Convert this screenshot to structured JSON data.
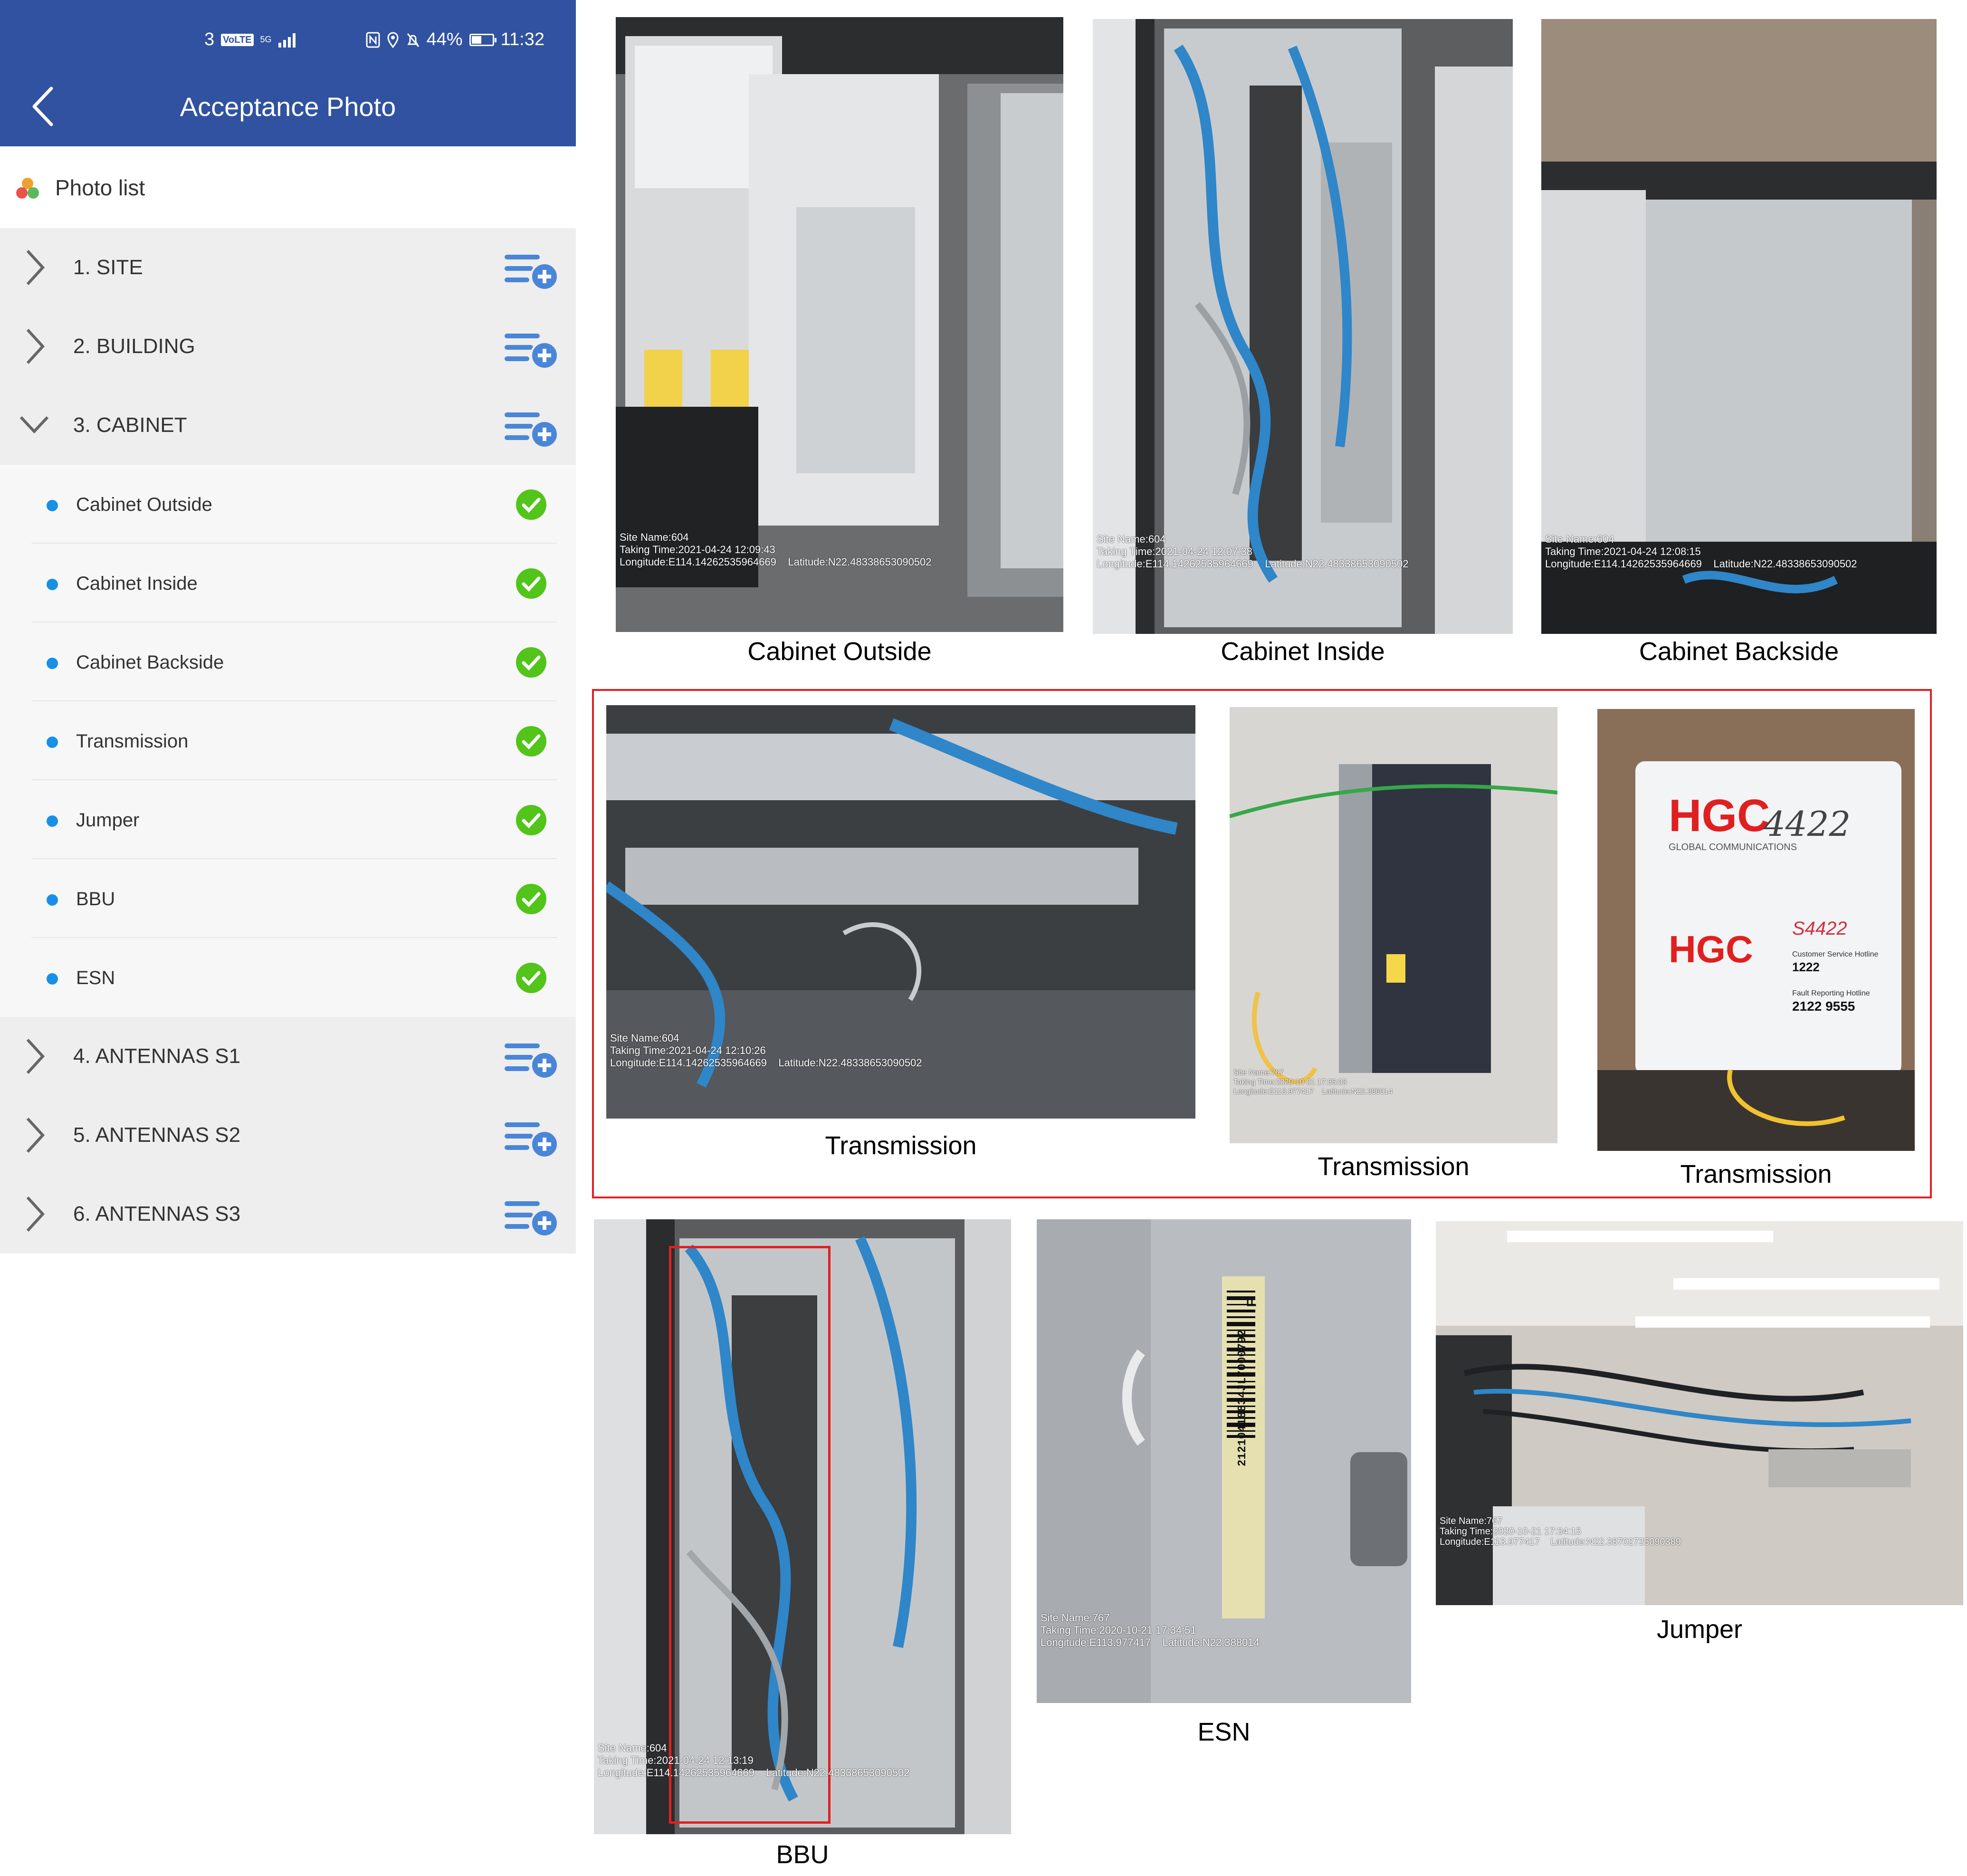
{
  "status_bar": {
    "network_left": "3",
    "volte": "VoLTE",
    "network_type": "5G",
    "battery": "44%",
    "time": "11:32"
  },
  "header": {
    "title": "Acceptance Photo"
  },
  "photo_list": {
    "label": "Photo list"
  },
  "groups": [
    {
      "label": "1. SITE"
    },
    {
      "label": "2. BUILDING"
    },
    {
      "label": "3. CABINET"
    },
    {
      "label": "4. ANTENNAS S1"
    },
    {
      "label": "5. ANTENNAS S2"
    },
    {
      "label": "6. ANTENNAS S3"
    }
  ],
  "cabinet_items": [
    {
      "label": "Cabinet Outside",
      "status": "done"
    },
    {
      "label": "Cabinet Inside",
      "status": "done"
    },
    {
      "label": "Cabinet Backside",
      "status": "done"
    },
    {
      "label": "Transmission",
      "status": "done"
    },
    {
      "label": "Jumper",
      "status": "done"
    },
    {
      "label": "BBU",
      "status": "done"
    },
    {
      "label": "ESN",
      "status": "done"
    }
  ],
  "photos": [
    {
      "caption": "Cabinet Outside",
      "overlay": "Site Name:604\nTaking Time:2021-04-24 12:09:43\nLongitude:E114.14262535964669    Latitude:N22.48338653090502"
    },
    {
      "caption": "Cabinet Inside",
      "overlay": "Site Name:604\nTaking Time:2021-04-24 12:07:38\nLongitude:E114.14262535964669    Latitude:N22.48338653090502"
    },
    {
      "caption": "Cabinet Backside",
      "overlay": "Site Name:604\nTaking Time:2021-04-24 12:08:15\nLongitude:E114.14262535964669    Latitude:N22.48338653090502"
    },
    {
      "caption": "Transmission",
      "overlay": "Site Name:604\nTaking Time:2021-04-24 12:10:26\nLongitude:E114.14262535964669    Latitude:N22.48338653090502"
    },
    {
      "caption": "Transmission",
      "overlay": "Site Name:767\nTaking Time:2020-10-21 17:35:03\nLongitude:E113.977417    Latitude:N22.388014"
    },
    {
      "caption": "Transmission",
      "overlay": ""
    },
    {
      "caption": "BBU",
      "overlay": "Site Name:604\nTaking Time:2021-04-24 12:13:19\nLongitude:E114.14262535964669    Latitude:N22.48338653090502"
    },
    {
      "caption": "ESN",
      "overlay": "Site Name:767\nTaking Time:2020-10-21 17:34:51\nLongitude:E113.977417    Latitude:N22.388014"
    },
    {
      "caption": "Jumper",
      "overlay": "Site Name:767\nTaking Time:2020-10-21 17:34:15\nLongitude:E113.977417    Latitude:N22.38702725090389"
    }
  ],
  "hgc_label": {
    "brand": "HGC",
    "handwritten_code": "4422",
    "company": "GLOBAL COMMUNICATIONS",
    "hotline_label": "Customer Service Hotline",
    "hotline": "1222",
    "fault_label": "Fault Reporting Hotline",
    "fault_number": "2122 9555",
    "handwritten_ref": "S4422"
  },
  "esn_barcode": "21210418834JL7000792",
  "esn_suffix": "F",
  "colors": {
    "header": "#3052a0",
    "check": "#52c41a",
    "dot": "#1890e6",
    "highlight": "#e02020"
  }
}
